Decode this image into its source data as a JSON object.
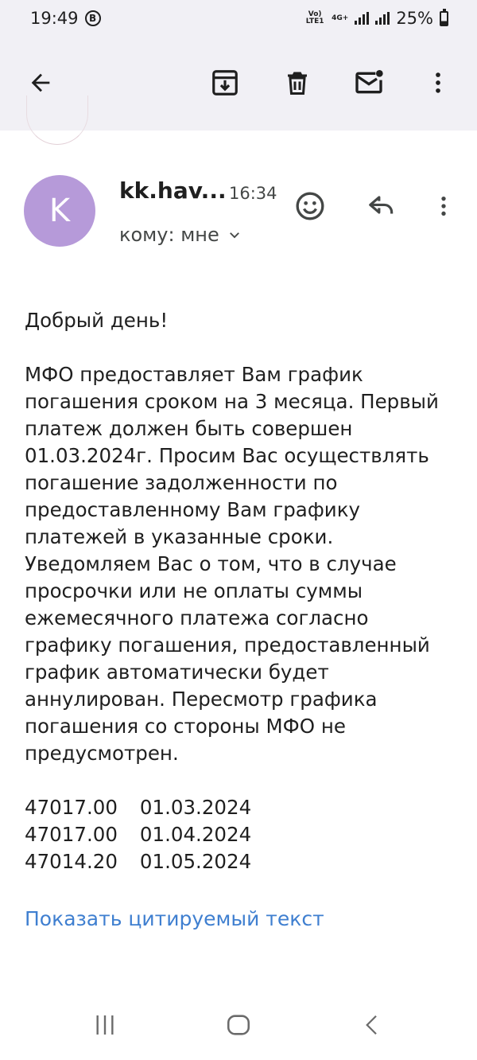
{
  "status_bar": {
    "time": "19:49",
    "badge": "B",
    "volte": "Vo) LTE1",
    "network": "4G+",
    "battery": "25%"
  },
  "toolbar": {
    "back_icon": "arrow-left-icon",
    "archive_icon": "archive-icon",
    "delete_icon": "trash-icon",
    "unread_icon": "mail-unread-icon",
    "more_icon": "more-vertical-icon"
  },
  "email": {
    "avatar_letter": "K",
    "avatar_color": "#b69ad9",
    "sender": "kk.hav...",
    "time": "16:34",
    "recipient": "кому: мне",
    "greeting": "Добрый день!",
    "body": "МФО предоставляет Вам график погашения сроком на 3 месяца. Первый платеж должен быть совершен 01.03.2024г. Просим Вас осуществлять погашение задолженности по предоставленному Вам графику платежей в указанные сроки. Уведомляем Вас о том, что в случае просрочки или не оплаты суммы ежемесячного платежа согласно графику погашения, предоставленный график автоматически будет аннулирован. Пересмотр графика погашения со стороны МФО не предусмотрен.",
    "payments": [
      {
        "amount": "47017.00",
        "date": "01.03.2024"
      },
      {
        "amount": "47017.00",
        "date": "01.04.2024"
      },
      {
        "amount": "47014.20",
        "date": "01.05.2024"
      }
    ],
    "show_quoted": "Показать цитируемый текст"
  },
  "colors": {
    "header_bg": "#f1f0f5",
    "link": "#3f7fd0"
  }
}
